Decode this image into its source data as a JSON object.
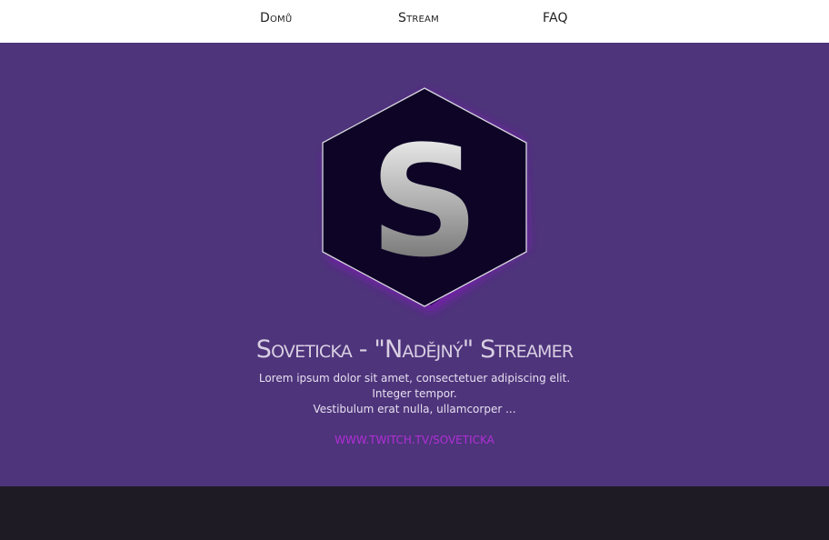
{
  "nav": {
    "items": [
      {
        "label": "Domů"
      },
      {
        "label": "Stream"
      },
      {
        "label": "FAQ"
      }
    ]
  },
  "hero": {
    "logo_letter": "S",
    "title": "Soveticka - \"Nadějný\" Streamer",
    "description": [
      "Lorem ipsum dolor sit amet, consectetuer adipiscing elit.",
      "Integer tempor.",
      "Vestibulum erat nulla, ullamcorper ..."
    ],
    "link": "WWW.TWITCH.TV/SOVETICKA"
  },
  "colors": {
    "nav_bg": "#ffffff",
    "hero_bg": "#4e347b",
    "footer_bg": "#1f1b25",
    "logo_bg": "#0d0426",
    "link": "#b12fd6",
    "title": "#d9cfe3"
  },
  "icons": {
    "logo": "hexagon-s-logo"
  }
}
